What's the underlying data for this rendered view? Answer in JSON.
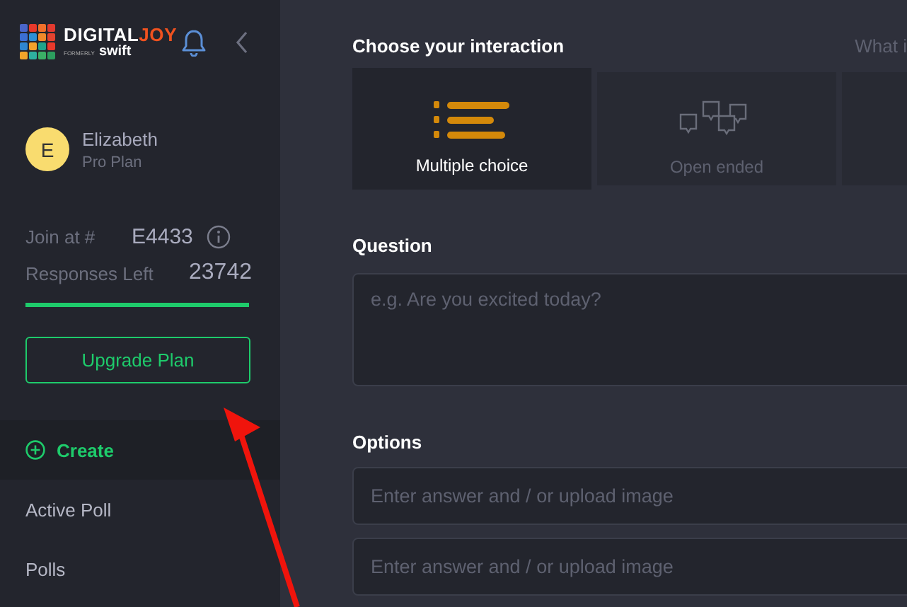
{
  "logo": {
    "word": "DIGITAL",
    "accent": "JOY",
    "tagline": "FORMERLY",
    "sub": "swift"
  },
  "user": {
    "initial": "E",
    "name": "Elizabeth",
    "plan": "Pro Plan"
  },
  "join": {
    "label": "Join at #",
    "code": "E4433"
  },
  "responses": {
    "label": "Responses Left",
    "count": "23742",
    "level": 1
  },
  "upgrade_button": "Upgrade Plan",
  "nav": [
    {
      "label": "Create",
      "kind": "create",
      "selected": true
    },
    {
      "label": "Active Poll",
      "kind": "plain",
      "selected": false
    },
    {
      "label": "Polls",
      "kind": "plain",
      "selected": false
    }
  ],
  "interaction": {
    "title": "Choose your interaction",
    "aside": "What i",
    "cards": [
      {
        "kind": "multiple",
        "label": "Multiple choice",
        "selected": true
      },
      {
        "kind": "open",
        "label": "Open ended",
        "selected": false
      },
      {
        "kind": "blank",
        "selected": false
      }
    ]
  },
  "question": {
    "label": "Question",
    "placeholder": "e.g. Are you excited today?"
  },
  "options": {
    "label": "Options",
    "fields": [
      {
        "placeholder": "Enter answer and / or upload image"
      },
      {
        "placeholder": "Enter answer and / or upload image"
      }
    ]
  }
}
